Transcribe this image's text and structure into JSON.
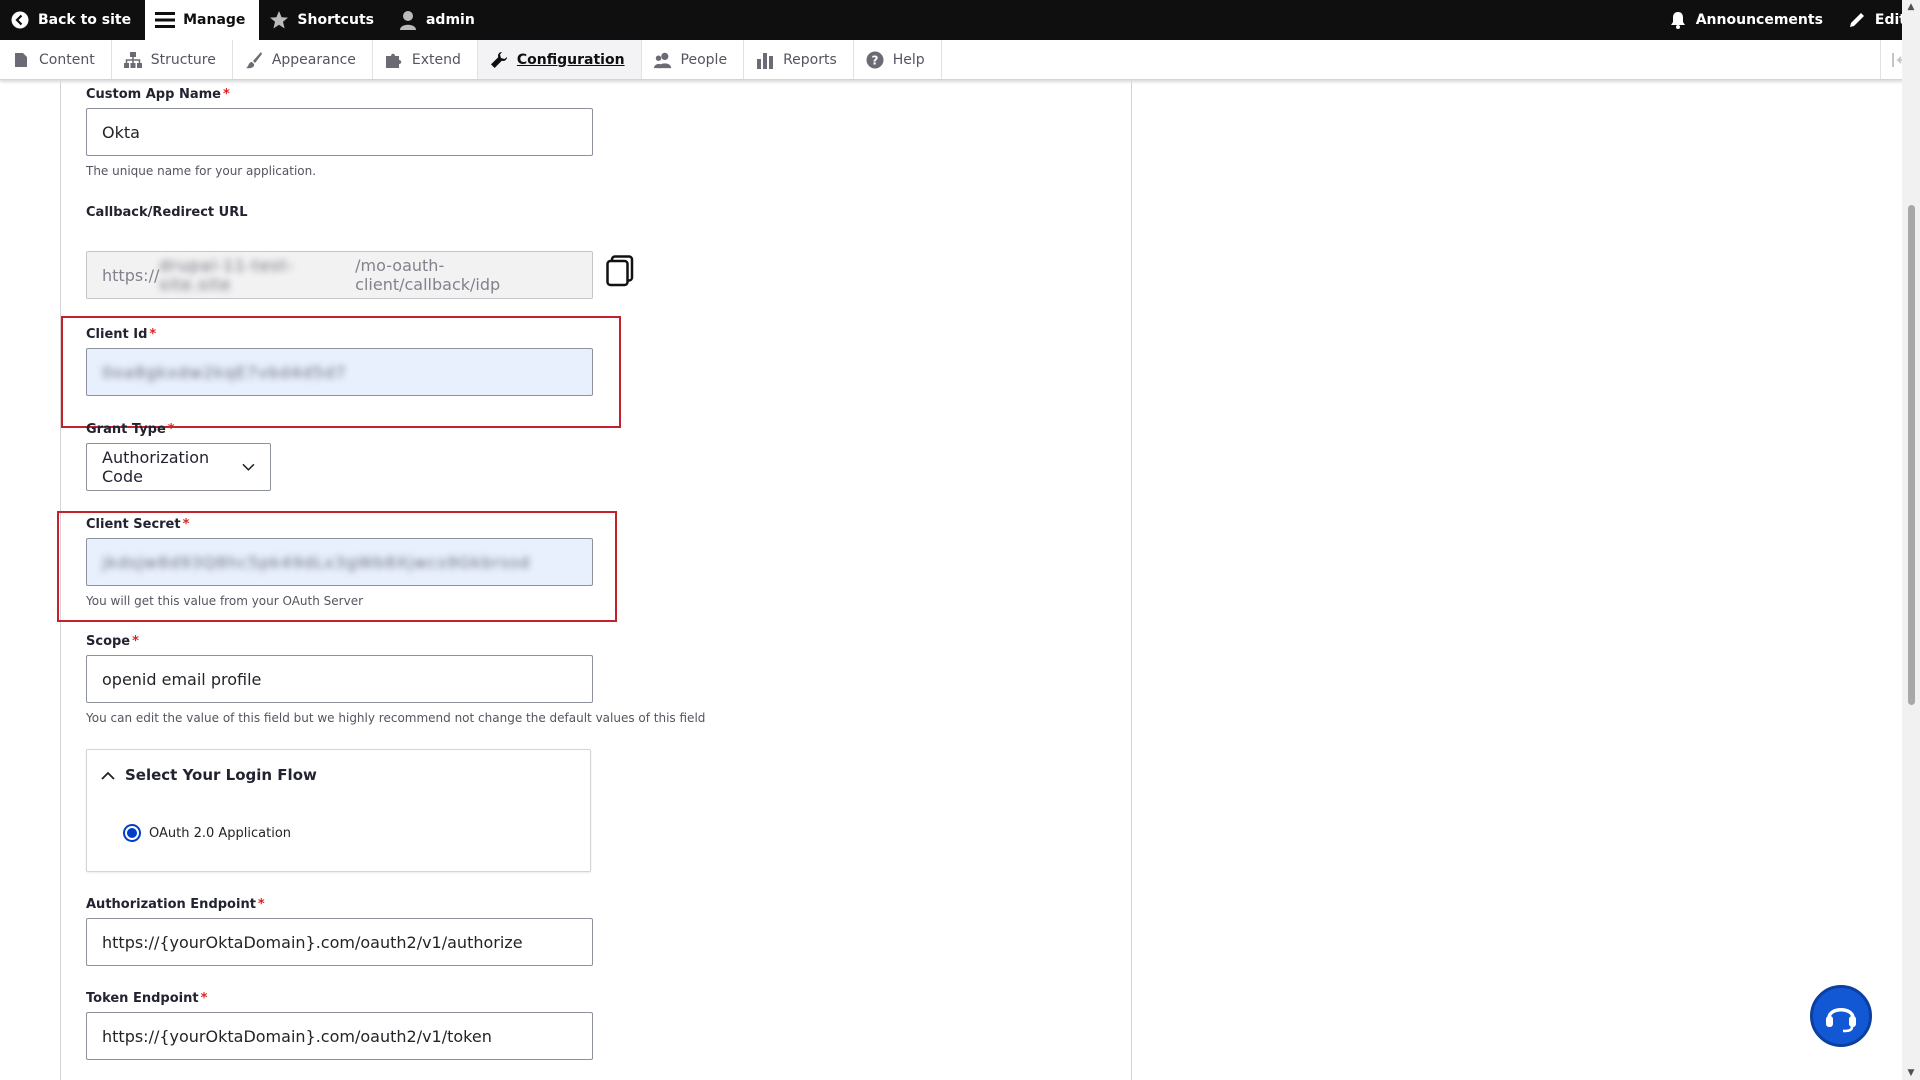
{
  "toolbar": {
    "back_to_site": "Back to site",
    "manage": "Manage",
    "shortcuts": "Shortcuts",
    "user": "admin",
    "announcements": "Announcements",
    "edit": "Edit"
  },
  "tray": {
    "items": [
      {
        "label": "Content",
        "icon": "page-icon"
      },
      {
        "label": "Structure",
        "icon": "sitemap-icon"
      },
      {
        "label": "Appearance",
        "icon": "brush-icon"
      },
      {
        "label": "Extend",
        "icon": "puzzle-icon"
      },
      {
        "label": "Configuration",
        "icon": "wrench-icon",
        "active": true
      },
      {
        "label": "People",
        "icon": "people-icon"
      },
      {
        "label": "Reports",
        "icon": "bar-chart-icon"
      },
      {
        "label": "Help",
        "icon": "help-icon"
      }
    ]
  },
  "form": {
    "custom_app_name": {
      "label": "Custom App Name",
      "value": "Okta",
      "description": "The unique name for your application."
    },
    "callback_url": {
      "label": "Callback/Redirect URL",
      "value_prefix": "https://",
      "value_hidden": "drupal-11-test-site.site",
      "value_suffix": "/mo-oauth-client/callback/idp"
    },
    "client_id": {
      "label": "Client Id",
      "value": "0oa8gkxdw2kqE7vbd4d5d7"
    },
    "grant_type": {
      "label": "Grant Type",
      "value": "Authorization Code"
    },
    "client_secret": {
      "label": "Client Secret",
      "value": "jkdsJw8d93Q8hc5pk49dLx3gWb8Xjwcs9Gkbrssd",
      "description": "You will get this value from your OAuth Server"
    },
    "scope": {
      "label": "Scope",
      "value": "openid email profile",
      "description": "You can edit the value of this field but we highly recommend not change the default values of this field"
    },
    "login_flow": {
      "title": "Select Your Login Flow",
      "option": "OAuth 2.0 Application"
    },
    "authorization_endpoint": {
      "label": "Authorization Endpoint",
      "value": "https://{yourOktaDomain}.com/oauth2/v1/authorize"
    },
    "token_endpoint": {
      "label": "Token Endpoint",
      "value": "https://{yourOktaDomain}.com/oauth2/v1/token"
    },
    "required_marker": "*"
  },
  "colors": {
    "toolbar_bg": "#0f0f0f",
    "required": "#dc2323",
    "highlight_border": "#c3222b",
    "radio": "#003ecc",
    "support_button": "#1257d4"
  }
}
